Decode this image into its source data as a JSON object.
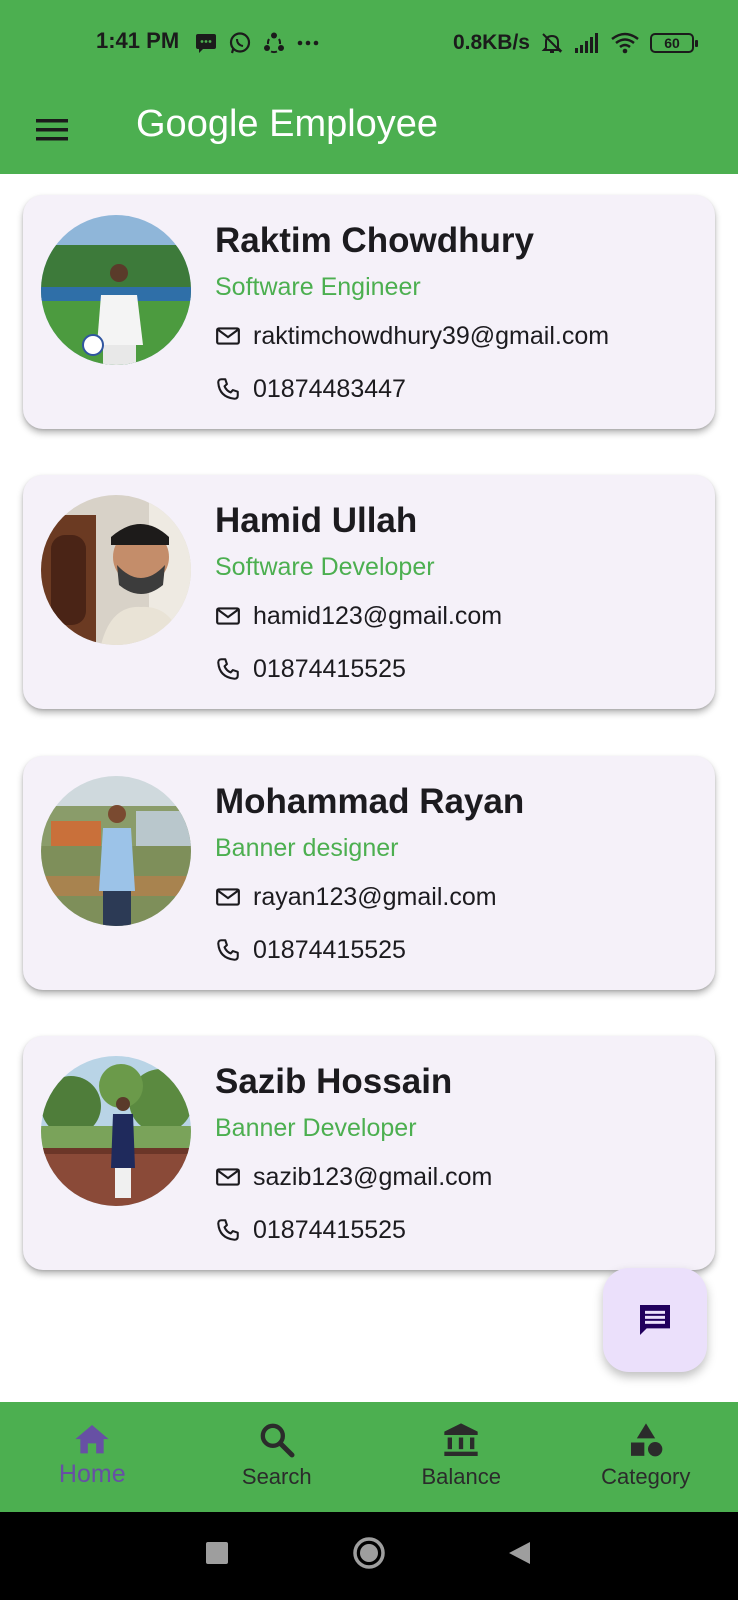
{
  "status_bar": {
    "time": "1:41 PM",
    "net_speed": "0.8KB/s",
    "battery": "60"
  },
  "app_bar": {
    "title": "Google Employee",
    "menu_icon": "menu-icon"
  },
  "employees": [
    {
      "name": "Raktim Chowdhury",
      "role": "Software Engineer",
      "email": "raktimchowdhury39@gmail.com",
      "phone": "01874483447"
    },
    {
      "name": "Hamid Ullah",
      "role": "Software Developer",
      "email": "hamid123@gmail.com",
      "phone": "01874415525"
    },
    {
      "name": "Mohammad Rayan",
      "role": "Banner designer",
      "email": "rayan123@gmail.com",
      "phone": "01874415525"
    },
    {
      "name": "Sazib Hossain",
      "role": "Banner Developer",
      "email": "sazib123@gmail.com",
      "phone": "01874415525"
    }
  ],
  "fab": {
    "icon": "message-icon"
  },
  "bottom_nav": {
    "items": [
      {
        "label": "Home",
        "icon": "home-icon",
        "active": true
      },
      {
        "label": "Search",
        "icon": "search-icon",
        "active": false
      },
      {
        "label": "Balance",
        "icon": "bank-icon",
        "active": false
      },
      {
        "label": "Category",
        "icon": "category-icon",
        "active": false
      }
    ]
  },
  "colors": {
    "primary": "#4caf50",
    "active": "#6750a4",
    "card": "#f5f1f9",
    "fab": "#ebe0fb"
  }
}
